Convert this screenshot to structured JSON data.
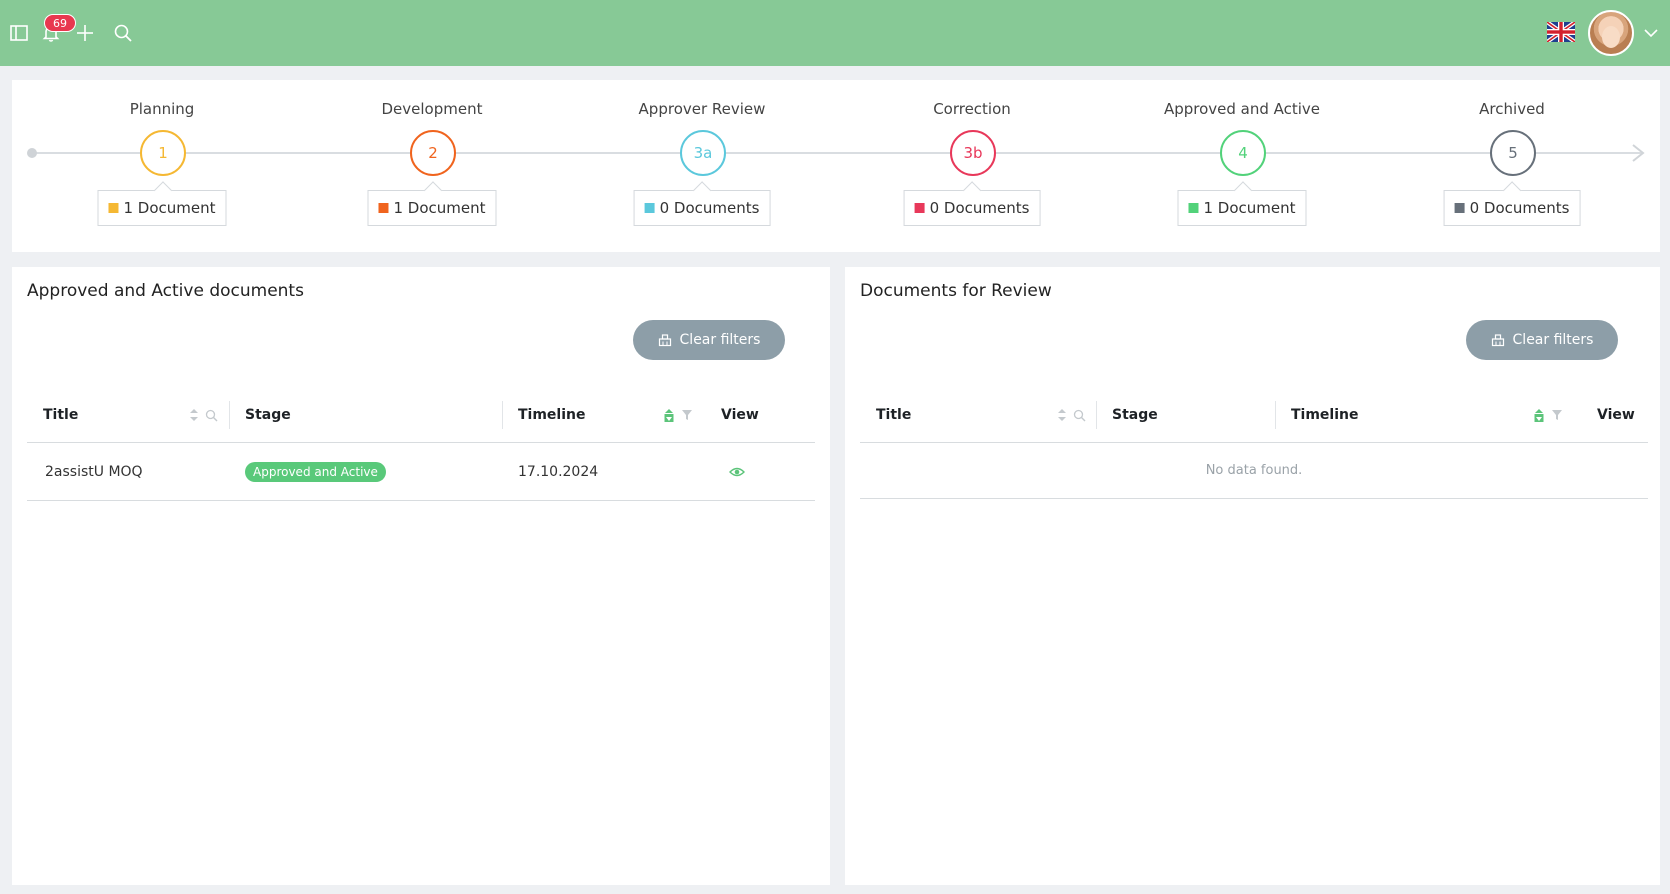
{
  "topbar": {
    "notifications_count": "69",
    "icons": [
      "sidebar-toggle-icon",
      "bell-icon",
      "plus-icon",
      "search-icon",
      "uk-flag-icon",
      "chevron-down-icon"
    ]
  },
  "pipeline": {
    "stages": [
      {
        "name": "Planning",
        "code": "1",
        "count": "1 Document",
        "color": "#f5b833"
      },
      {
        "name": "Development",
        "code": "2",
        "count": "1 Document",
        "color": "#f0641e"
      },
      {
        "name": "Approver Review",
        "code": "3a",
        "count": "0 Documents",
        "color": "#5bc8dc"
      },
      {
        "name": "Correction",
        "code": "3b",
        "count": "0 Documents",
        "color": "#e8385a"
      },
      {
        "name": "Approved and Active",
        "code": "4",
        "count": "1 Document",
        "color": "#52d27a"
      },
      {
        "name": "Archived",
        "code": "5",
        "count": "0 Documents",
        "color": "#67707a"
      }
    ]
  },
  "left_panel": {
    "title": "Approved and Active documents",
    "clear_filters_label": "Clear filters",
    "columns": {
      "title": "Title",
      "stage": "Stage",
      "timeline": "Timeline",
      "view": "View"
    },
    "rows": [
      {
        "title": "2assistU MOQ",
        "stage": "Approved and Active",
        "timeline": "17.10.2024"
      }
    ]
  },
  "right_panel": {
    "title": "Documents for Review",
    "clear_filters_label": "Clear filters",
    "columns": {
      "title": "Title",
      "stage": "Stage",
      "timeline": "Timeline",
      "view": "View"
    },
    "empty_text": "No data found."
  },
  "colors": {
    "topbar": "#87c996",
    "badge_green": "#59c97a",
    "button_gray": "#8d9ea8",
    "notif_red": "#e8384f"
  }
}
